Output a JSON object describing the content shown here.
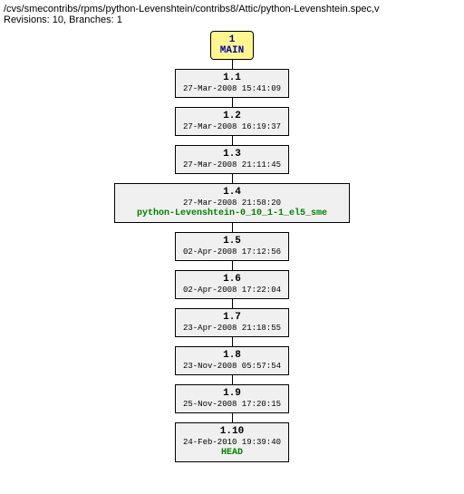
{
  "header": {
    "path": "/cvs/smecontribs/rpms/python-Levenshtein/contribs8/Attic/python-Levenshtein.spec,v",
    "revisions": "Revisions: 10, Branches: 1"
  },
  "branch": {
    "num": "1",
    "name": "MAIN"
  },
  "nodes": [
    {
      "rev": "1.1",
      "date": "27-Mar-2008 15:41:09",
      "tag": ""
    },
    {
      "rev": "1.2",
      "date": "27-Mar-2008 16:19:37",
      "tag": ""
    },
    {
      "rev": "1.3",
      "date": "27-Mar-2008 21:11:45",
      "tag": ""
    },
    {
      "rev": "1.4",
      "date": "27-Mar-2008 21:58:20",
      "tag": "python-Levenshtein-0_10_1-1_el5_sme"
    },
    {
      "rev": "1.5",
      "date": "02-Apr-2008 17:12:56",
      "tag": ""
    },
    {
      "rev": "1.6",
      "date": "02-Apr-2008 17:22:04",
      "tag": ""
    },
    {
      "rev": "1.7",
      "date": "23-Apr-2008 21:18:55",
      "tag": ""
    },
    {
      "rev": "1.8",
      "date": "23-Nov-2008 05:57:54",
      "tag": ""
    },
    {
      "rev": "1.9",
      "date": "25-Nov-2008 17:20:15",
      "tag": ""
    },
    {
      "rev": "1.10",
      "date": "24-Feb-2010 19:39:40",
      "tag": "HEAD"
    }
  ]
}
